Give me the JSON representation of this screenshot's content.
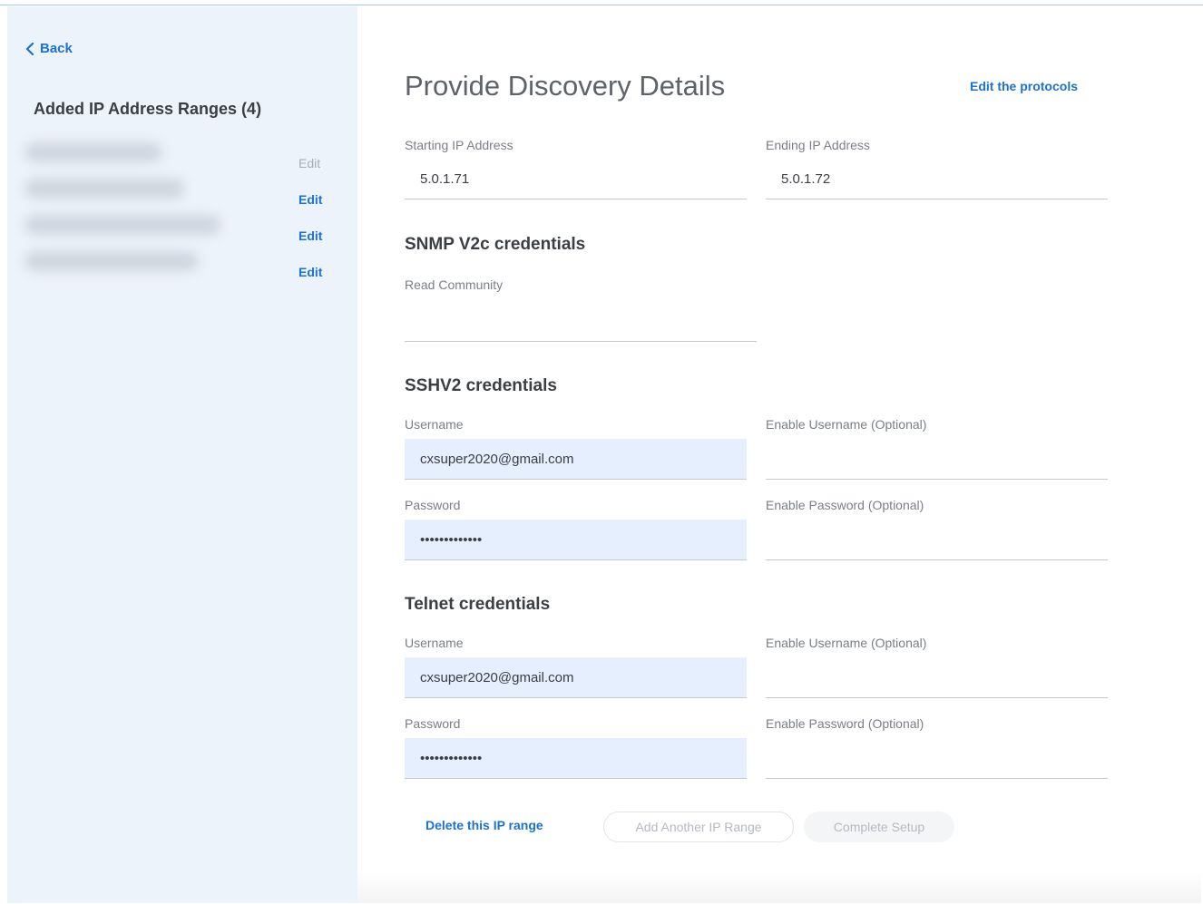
{
  "sidebar": {
    "back_label": "Back",
    "title": "Added IP Address Ranges (4)",
    "edit_links": [
      {
        "label": "Edit",
        "muted": true
      },
      {
        "label": "Edit",
        "muted": false
      },
      {
        "label": "Edit",
        "muted": false
      },
      {
        "label": "Edit",
        "muted": false
      }
    ]
  },
  "main": {
    "title": "Provide Discovery Details",
    "edit_protocols_label": "Edit the protocols",
    "ip_range": {
      "start_label": "Starting IP Address",
      "start_value": "5.0.1.71",
      "end_label": "Ending IP Address",
      "end_value": "5.0.1.72"
    },
    "snmp": {
      "title": "SNMP V2c credentials",
      "read_community_label": "Read Community",
      "read_community_value": ""
    },
    "ssh": {
      "title": "SSHV2 credentials",
      "username_label": "Username",
      "username_value": "cxsuper2020@gmail.com",
      "enable_username_label": "Enable Username (Optional)",
      "enable_username_value": "",
      "password_label": "Password",
      "password_value": "•••••••••••••",
      "enable_password_label": "Enable Password (Optional)",
      "enable_password_value": ""
    },
    "telnet": {
      "title": "Telnet credentials",
      "username_label": "Username",
      "username_value": "cxsuper2020@gmail.com",
      "enable_username_label": "Enable Username (Optional)",
      "enable_username_value": "",
      "password_label": "Password",
      "password_value": "•••••••••••••",
      "enable_password_label": "Enable Password (Optional)",
      "enable_password_value": ""
    },
    "footer": {
      "delete_label": "Delete this IP range",
      "add_another_label": "Add Another IP Range",
      "complete_label": "Complete Setup"
    }
  },
  "colors": {
    "accent": "#1a72d1",
    "sidebar_bg": "#edf3fa",
    "filled_field_bg": "#e6effd"
  }
}
